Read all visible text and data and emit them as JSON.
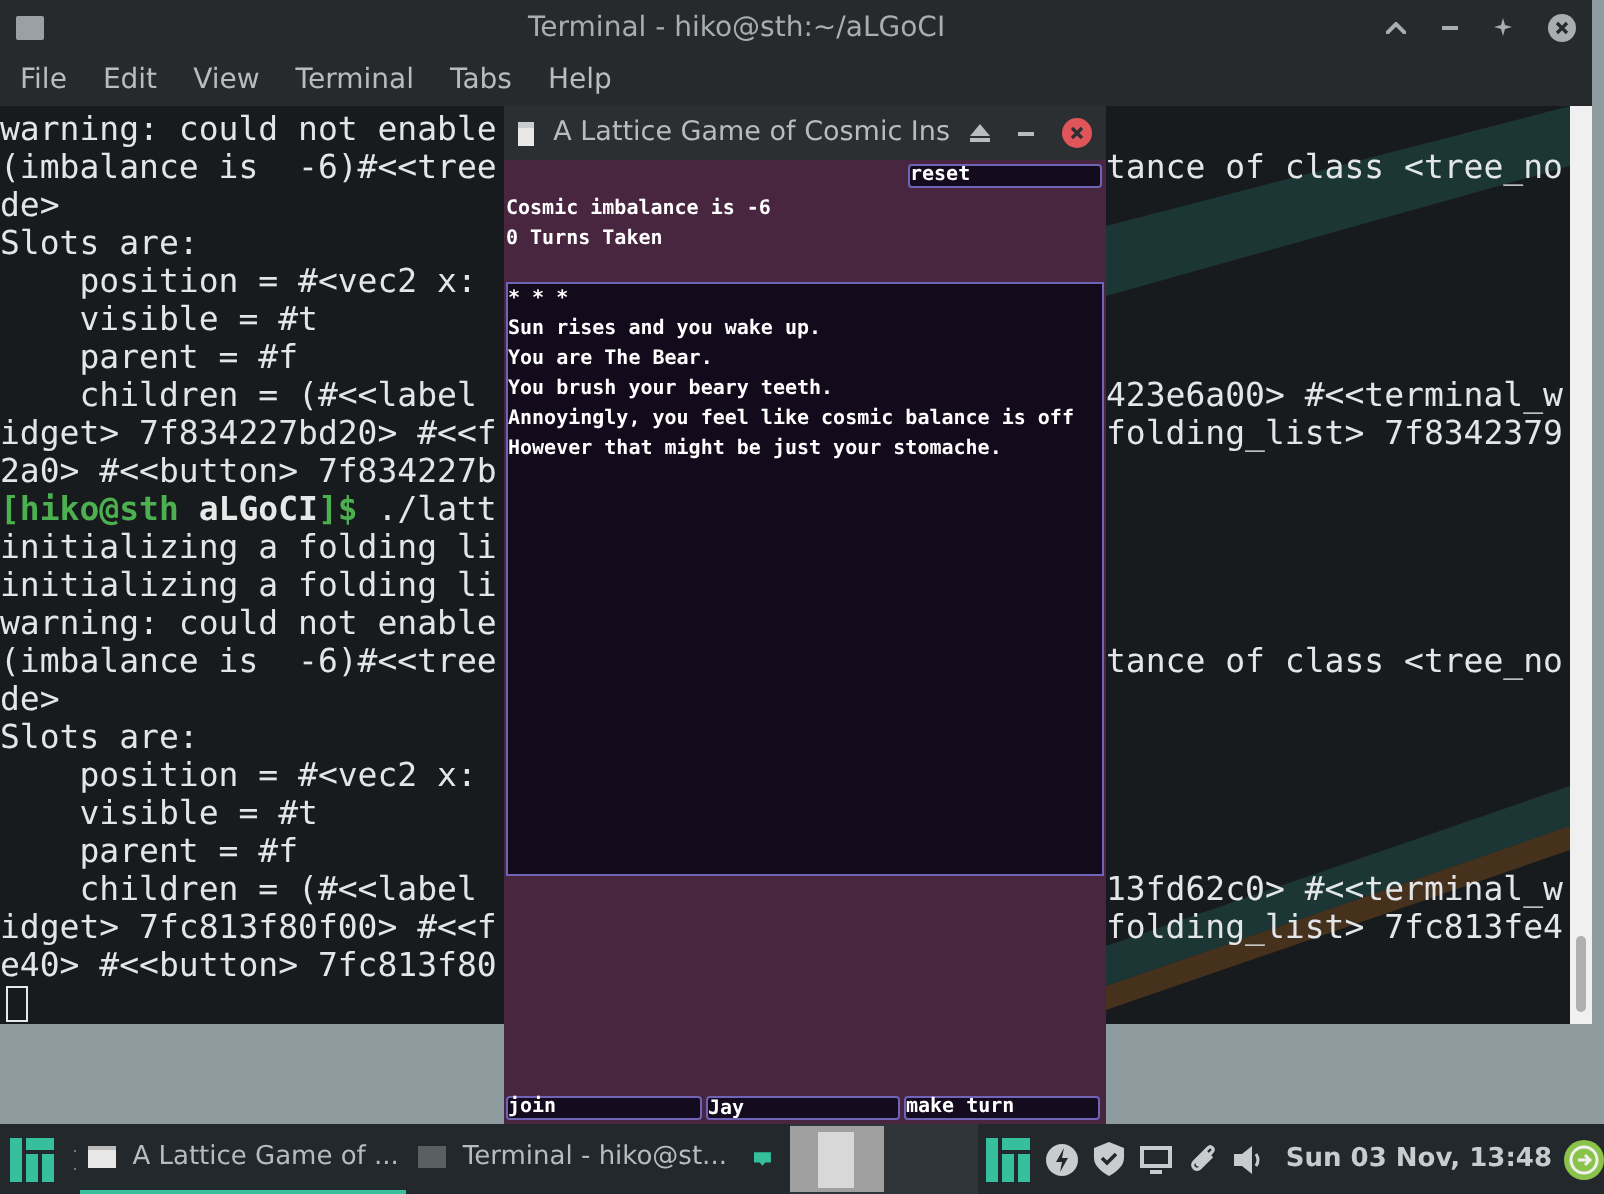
{
  "terminal": {
    "title": "Terminal - hiko@sth:~/aLGoCI",
    "menu": [
      "File",
      "Edit",
      "View",
      "Terminal",
      "Tabs",
      "Help"
    ],
    "lines": [
      {
        "kind": "text",
        "left": "warning: could not enable"
      },
      {
        "kind": "text",
        "left": "(imbalance is  -6)#<<tree",
        "right": "tance of class <tree_no"
      },
      {
        "kind": "text",
        "left": "de>"
      },
      {
        "kind": "text",
        "left": "Slots are:"
      },
      {
        "kind": "text",
        "left": "    position = #<vec2 x:"
      },
      {
        "kind": "text",
        "left": "    visible = #t"
      },
      {
        "kind": "text",
        "left": "    parent = #f"
      },
      {
        "kind": "text",
        "left": "    children = (#<<label",
        "right": "423e6a00> #<<terminal_w"
      },
      {
        "kind": "text",
        "left": "idget> 7f834227bd20> #<<f",
        "right": "folding_list> 7f8342379"
      },
      {
        "kind": "text",
        "left": "2a0> #<<button> 7f834227b"
      },
      {
        "kind": "prompt",
        "user": "[hiko@sth",
        "dir": "aLGoCI",
        "end": "]$",
        "command": " ./latt"
      },
      {
        "kind": "text",
        "left": "initializing a folding li"
      },
      {
        "kind": "text",
        "left": "initializing a folding li"
      },
      {
        "kind": "text",
        "left": "warning: could not enable"
      },
      {
        "kind": "text",
        "left": "(imbalance is  -6)#<<tree",
        "right": "tance of class <tree_no"
      },
      {
        "kind": "text",
        "left": "de>"
      },
      {
        "kind": "text",
        "left": "Slots are:"
      },
      {
        "kind": "text",
        "left": "    position = #<vec2 x:"
      },
      {
        "kind": "text",
        "left": "    visible = #t"
      },
      {
        "kind": "text",
        "left": "    parent = #f"
      },
      {
        "kind": "text",
        "left": "    children = (#<<label",
        "right": "13fd62c0> #<<terminal_w"
      },
      {
        "kind": "text",
        "left": "idget> 7fc813f80f00> #<<f",
        "right": "folding_list> 7fc813fe4"
      },
      {
        "kind": "text",
        "left": "e40> #<<button> 7fc813f80"
      },
      {
        "kind": "cursor"
      }
    ]
  },
  "game": {
    "title": "A Lattice Game of Cosmic Ins",
    "reset": "reset",
    "status": [
      "Cosmic imbalance is -6",
      "0 Turns Taken"
    ],
    "log": [
      "* * *",
      "Sun rises and you wake up.",
      "You are The Bear.",
      "You brush your beary teeth.",
      "Annoyingly, you feel like cosmic balance is off",
      "However that might be just your stomache."
    ],
    "controls": [
      {
        "kind": "button",
        "label": "join"
      },
      {
        "kind": "field",
        "value": "Jay"
      },
      {
        "kind": "button",
        "label": "make turn"
      }
    ]
  },
  "taskbar": {
    "tasks": [
      {
        "kind": "window",
        "label": "A Lattice Game of ...",
        "selected": true
      },
      {
        "kind": "terminal",
        "label": "Terminal - hiko@st...",
        "selected": false
      }
    ],
    "clock": "Sun 03 Nov, 13:48"
  }
}
